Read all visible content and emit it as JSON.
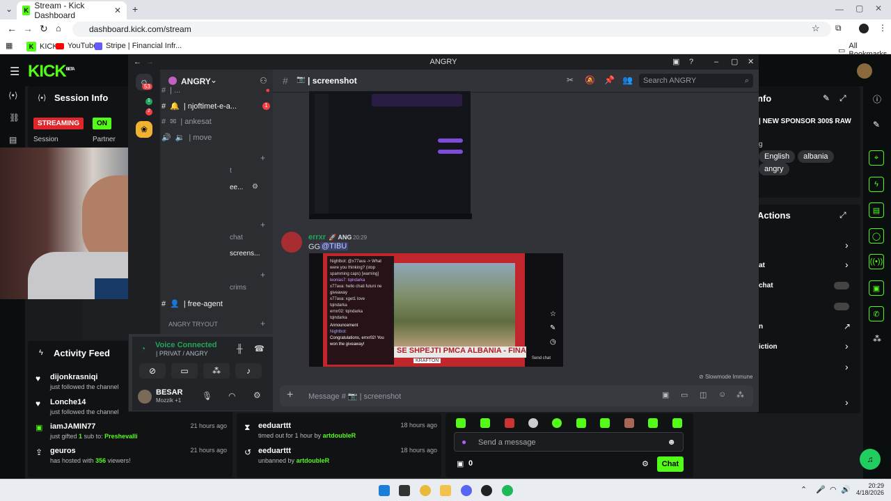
{
  "browser": {
    "tab_title": "Stream - Kick Dashboard",
    "url": "dashboard.kick.com/stream",
    "bookmarks": [
      "KICK",
      "YouTube",
      "Stripe | Financial Infr...",
      "All Bookmarks"
    ]
  },
  "kick": {
    "logo": "KICK",
    "logo_sup": "BETA",
    "session": {
      "title": "Session Info",
      "status": "STREAMING",
      "status_label": "Session",
      "partner": "ON",
      "partner_label": "Partner"
    },
    "stream_title": "| NEW SPONSOR 300$ RAW",
    "tags": [
      "English",
      "albania",
      "angry"
    ],
    "actions_title": "Actions",
    "actions": [
      "at",
      "chat",
      "",
      "n",
      "iction"
    ],
    "activity": {
      "title": "Activity Feed",
      "items": [
        {
          "user": "dijonkrasniqi",
          "sub": "just followed the channel",
          "time": ""
        },
        {
          "user": "Lonche14",
          "sub": "just followed the channel",
          "time": ""
        },
        {
          "user": "iamJAMIN77",
          "sub_pre": "just gifted",
          "sub_num": "1",
          "sub_mid": "sub to:",
          "sub_target": "Preshevalli",
          "time": "21 hours ago"
        },
        {
          "user": "geuros",
          "sub_pre": "has hosted with",
          "sub_num": "356",
          "sub_post": "viewers!",
          "time": "21 hours ago"
        }
      ]
    },
    "moderation": [
      {
        "user": "eeduarttt",
        "pre": "timed out for 1 hour by",
        "by": "artdoubleR",
        "time": "18 hours ago"
      },
      {
        "user": "eeduarttt",
        "pre": "unbanned by",
        "by": "artdoubleR",
        "time": "18 hours ago"
      }
    ],
    "chat_placeholder": "Send a message",
    "chat_button": "Chat",
    "points": "0",
    "cutoff_labels": {
      "t1": "t",
      "t2": "ee...",
      "t3": "chat",
      "t4": "screens...",
      "t5": "crims",
      "info": "nfo",
      "g": "g"
    }
  },
  "discord": {
    "window_title": "ANGRY",
    "server": "ANGRY",
    "unread": "53",
    "badge1": "1",
    "badge2": "2",
    "channels": [
      "| njoftimet-e-a...",
      "| ankesat",
      "| move",
      "| free-agent"
    ],
    "channel_top": "| ...",
    "category": "ANGRY TRYOUT",
    "channel_badge": "1",
    "voice": {
      "status": "Voice Connected",
      "detail": "| PRIVAT / ANGRY"
    },
    "user": {
      "name": "BESAR",
      "status": "Mozzik +1"
    },
    "current_channel": "| screenshot",
    "search": "Search ANGRY",
    "message": {
      "author": "errxr",
      "role": "ANG",
      "time": "20:29",
      "text_pre": "GG",
      "mention": "@TIBU"
    },
    "input_placeholder": "Message # 📷 | screenshot",
    "slowmode": "Slowmode Immune",
    "embedded": {
      "chat_lines": [
        "Nightbot: @x77ava -> What were you thinking? (stop spamming caps) [warning]",
        "leonias7: tqindarka",
        "x77ava: hello chati futuni ne giveaway",
        "x77ava: xget1 love",
        "tqindarka",
        "errxr02: tqindarka",
        "tqindarka"
      ],
      "announcement": "Announcement",
      "announce_user": "Nightbot:",
      "announce_text": "Congratulations, errxr02! You won the giveaway!",
      "banner": "SE SHPEJTI   PMCA ALBANIA - FINALET DI",
      "sponsor": "KRAFTON",
      "send": "Send chat"
    }
  },
  "taskbar": {
    "time": "20:29",
    "date": "4/18/2026"
  }
}
